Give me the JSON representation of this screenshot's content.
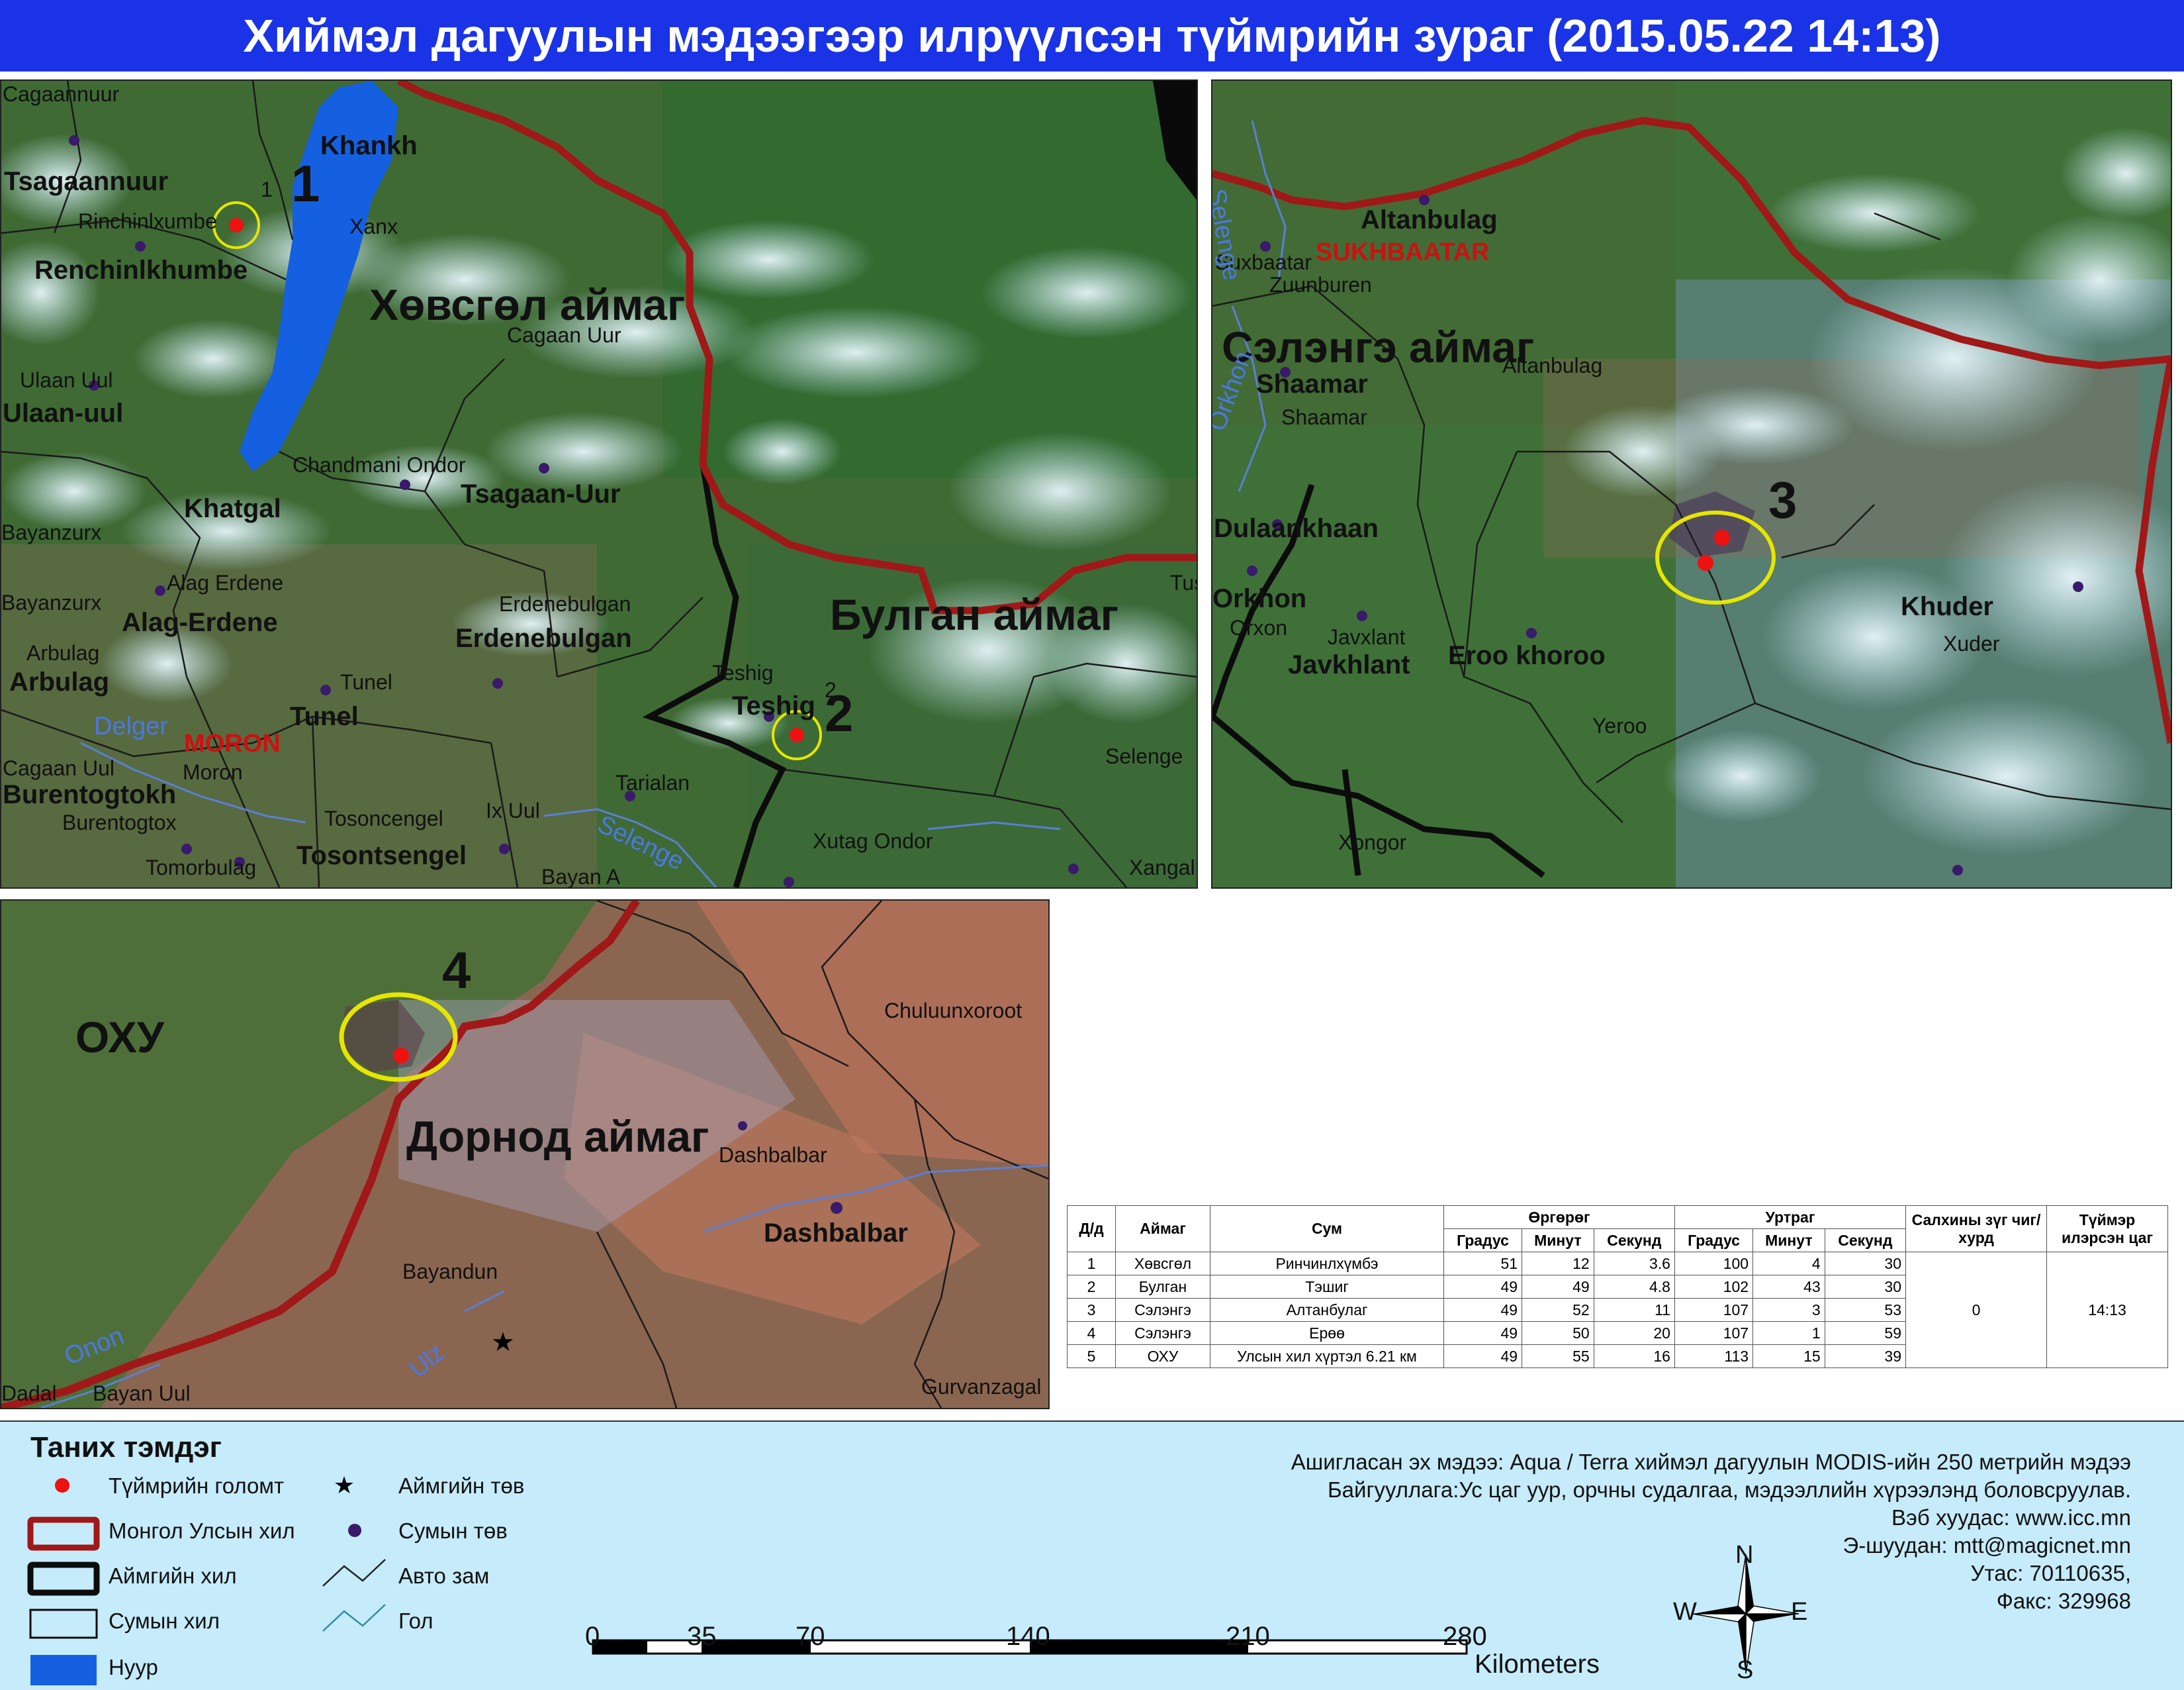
{
  "title": "Хиймэл дагуулын мэдээгээр илрүүлсэн түймрийн зураг  (2015.05.22 14:13)",
  "panel1": {
    "place_labels": [
      {
        "text": "Cagaannuur",
        "cls": "s"
      },
      {
        "text": "Khankh",
        "cls": "b"
      },
      {
        "text": "Tsagaannuur",
        "cls": "b"
      },
      {
        "text": "Rinchinlxumbe",
        "cls": "s"
      },
      {
        "text": "Xanx",
        "cls": "s"
      },
      {
        "text": "Renchinlkhumbe",
        "cls": "b"
      },
      {
        "text": "Cagaan Uur",
        "cls": "s"
      },
      {
        "text": "Ulaan Uul",
        "cls": "s"
      },
      {
        "text": "Ulaan-uul",
        "cls": "b"
      },
      {
        "text": "Chandmani Ondor",
        "cls": "s"
      },
      {
        "text": "Tsagaan-Uur",
        "cls": "b"
      },
      {
        "text": "Khatgal",
        "cls": "b"
      },
      {
        "text": "Bayanzurx",
        "cls": "s"
      },
      {
        "text": "Alag Erdene",
        "cls": "s"
      },
      {
        "text": "Bayanzurx",
        "cls": "s"
      },
      {
        "text": "Alag-Erdene",
        "cls": "b"
      },
      {
        "text": "Erdenebulgan",
        "cls": "s"
      },
      {
        "text": "Erdenebulgan",
        "cls": "b"
      },
      {
        "text": "Arbulag",
        "cls": "s"
      },
      {
        "text": "Arbulag",
        "cls": "b"
      },
      {
        "text": "Tunel",
        "cls": "s"
      },
      {
        "text": "Tunel",
        "cls": "b"
      },
      {
        "text": "Teshig",
        "cls": "s"
      },
      {
        "text": "Teshig",
        "cls": "b"
      },
      {
        "text": "Cagaan Uul",
        "cls": "s"
      },
      {
        "text": "Moron",
        "cls": "s"
      },
      {
        "text": "Burentogtokh",
        "cls": "b"
      },
      {
        "text": "Burentogtox",
        "cls": "s"
      },
      {
        "text": "Tosoncengel",
        "cls": "s"
      },
      {
        "text": "Ix Uul",
        "cls": "s"
      },
      {
        "text": "Tarialan",
        "cls": "s"
      },
      {
        "text": "Tosontsengel",
        "cls": "b"
      },
      {
        "text": "Tomorbulag",
        "cls": "s"
      },
      {
        "text": "Xutag Ondor",
        "cls": "s"
      },
      {
        "text": "Bayan A",
        "cls": "s"
      },
      {
        "text": "Selenge",
        "cls": "s"
      },
      {
        "text": "Xangal",
        "cls": "s"
      },
      {
        "text": "Tusi",
        "cls": "s"
      }
    ],
    "aimag_labels": [
      "Хөвсгөл аймаг",
      "Булган аймаг"
    ],
    "red_labels": [
      "MORON"
    ],
    "river_labels": [
      "Delger",
      "Selenge"
    ],
    "fire_numbers": [
      "1",
      "2"
    ],
    "small_numbers": [
      "1",
      "2"
    ]
  },
  "panel2": {
    "place_labels": [
      {
        "text": "Altanbulag",
        "cls": "b"
      },
      {
        "text": "Suxbaatar",
        "cls": "s"
      },
      {
        "text": "Zuunburen",
        "cls": "s"
      },
      {
        "text": "Altanbulag",
        "cls": "s"
      },
      {
        "text": "Shaamar",
        "cls": "b"
      },
      {
        "text": "Shaamar",
        "cls": "s"
      },
      {
        "text": "Dulaankhaan",
        "cls": "b"
      },
      {
        "text": "Orkhon",
        "cls": "b"
      },
      {
        "text": "Orxon",
        "cls": "s"
      },
      {
        "text": "Javxlant",
        "cls": "s"
      },
      {
        "text": "Javkhlant",
        "cls": "b"
      },
      {
        "text": "Eroo khoroo",
        "cls": "b"
      },
      {
        "text": "Khuder",
        "cls": "b"
      },
      {
        "text": "Xuder",
        "cls": "s"
      },
      {
        "text": "Yeroo",
        "cls": "s"
      },
      {
        "text": "Xongor",
        "cls": "s"
      }
    ],
    "aimag_labels": [
      "Сэлэнгэ аймаг"
    ],
    "red_labels": [
      "SUKHBAATAR"
    ],
    "river_labels": [
      "Selenge",
      "Orkhon"
    ],
    "fire_numbers": [
      "3"
    ]
  },
  "panel3": {
    "place_labels": [
      {
        "text": "Chuluunxoroot",
        "cls": "s"
      },
      {
        "text": "Dashbalbar",
        "cls": "s"
      },
      {
        "text": "Dashbalbar",
        "cls": "b"
      },
      {
        "text": "Bayandun",
        "cls": "s"
      },
      {
        "text": "Dadal",
        "cls": "s"
      },
      {
        "text": "Bayan Uul",
        "cls": "s"
      },
      {
        "text": "Gurvanzagal",
        "cls": "s"
      }
    ],
    "aimag_labels": [
      "ОХУ",
      "Дорнод аймаг"
    ],
    "river_labels": [
      "Onon",
      "Ulz"
    ],
    "fire_numbers": [
      "4"
    ]
  },
  "table": {
    "headers": {
      "no": "Д/д",
      "aimag": "Аймаг",
      "sum": "Сум",
      "lat": "Өргөрөг",
      "lon": "Уртраг",
      "deg": "Градус",
      "min": "Минут",
      "sec": "Секунд",
      "wind": "Салхины зүг чиг/хурд",
      "time": "Түймэр илэрсэн цаг"
    },
    "rows": [
      {
        "no": "1",
        "aimag": "Хөвсгөл",
        "sum": "Ринчинлхүмбэ",
        "lat_d": "51",
        "lat_m": "12",
        "lat_s": "3.6",
        "lon_d": "100",
        "lon_m": "4",
        "lon_s": "30"
      },
      {
        "no": "2",
        "aimag": "Булган",
        "sum": "Тэшиг",
        "lat_d": "49",
        "lat_m": "49",
        "lat_s": "4.8",
        "lon_d": "102",
        "lon_m": "43",
        "lon_s": "30"
      },
      {
        "no": "3",
        "aimag": "Сэлэнгэ",
        "sum": "Алтанбулаг",
        "lat_d": "49",
        "lat_m": "52",
        "lat_s": "11",
        "lon_d": "107",
        "lon_m": "3",
        "lon_s": "53"
      },
      {
        "no": "4",
        "aimag": "Сэлэнгэ",
        "sum": "Ерөө",
        "lat_d": "49",
        "lat_m": "50",
        "lat_s": "20",
        "lon_d": "107",
        "lon_m": "1",
        "lon_s": "59"
      },
      {
        "no": "5",
        "aimag": "ОХУ",
        "sum": "Улсын хил хүртэл 6.21 км",
        "lat_d": "49",
        "lat_m": "55",
        "lat_s": "16",
        "lon_d": "113",
        "lon_m": "15",
        "lon_s": "39"
      }
    ],
    "wind_value": "0",
    "time_value": "14:13"
  },
  "legend": {
    "title": "Таних тэмдэг",
    "items_left": [
      "Түймрийн голомт",
      "Монгол Улсын хил",
      "Аймгийн хил",
      "Сумын хил",
      "Нуур"
    ],
    "items_right": [
      "Аймгийн төв",
      "Сумын төв",
      "Авто зам",
      "Гол"
    ],
    "colors": {
      "fire": "#ee1111",
      "border": "#a01818",
      "lake": "#1560e0",
      "river": "#2f8fa0",
      "sum_center": "#3a1a6a"
    }
  },
  "info": {
    "source": "Ашигласан эх мэдээ: Aqua / Terra хиймэл дагуулын MODIS-ийн 250 метрийн мэдээ",
    "org": "Байгууллага:Ус цаг уур, орчны судалгаа, мэдээллийн хүрээлэнд боловсруулав.",
    "web": "Вэб хуудас: www.icc.mn",
    "email": "Э-шуудан: mtt@magicnet.mn",
    "phone": "Утас: 70110635,",
    "fax": "Факс: 329968"
  },
  "scale": {
    "ticks": [
      "0",
      "35",
      "70",
      "140",
      "210",
      "280"
    ],
    "unit": "Kilometers"
  },
  "compass": {
    "n": "N",
    "s": "S",
    "e": "E",
    "w": "W"
  }
}
